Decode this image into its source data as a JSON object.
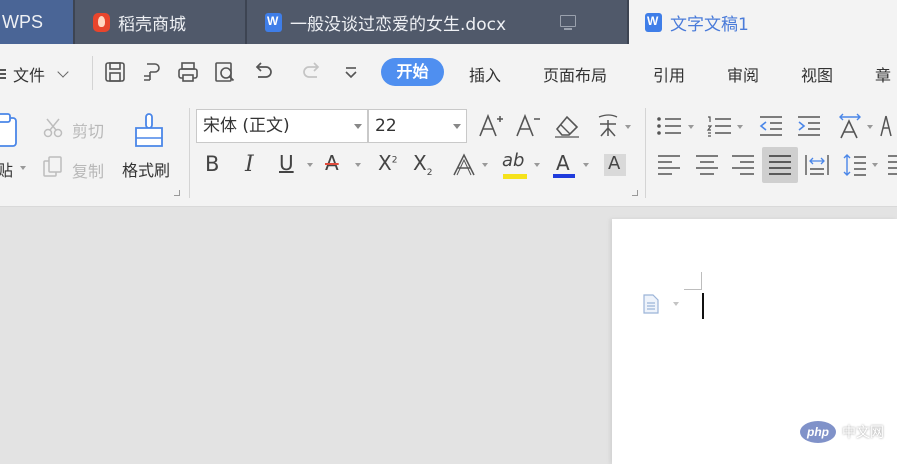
{
  "tabs": {
    "wps": "WPS",
    "store": "稻壳商城",
    "doc1": "一般没谈过恋爱的女生.docx",
    "doc2": "文字文稿1"
  },
  "menu": {
    "file": "文件",
    "tabs": [
      "开始",
      "插入",
      "页面布局",
      "引用",
      "审阅",
      "视图",
      "章"
    ]
  },
  "ribbon": {
    "paste": "粘贴",
    "cut": "剪切",
    "copy": "复制",
    "format_painter": "格式刷",
    "font_name": "宋体 (正文)",
    "font_size": "22"
  },
  "watermark": {
    "logo": "php",
    "text": "中文网"
  },
  "colors": {
    "accent": "#4f8ff0",
    "tabbar": "#3d4452",
    "highlight_yellow": "#f5e21b",
    "font_color_blue": "#1f3bdc"
  }
}
